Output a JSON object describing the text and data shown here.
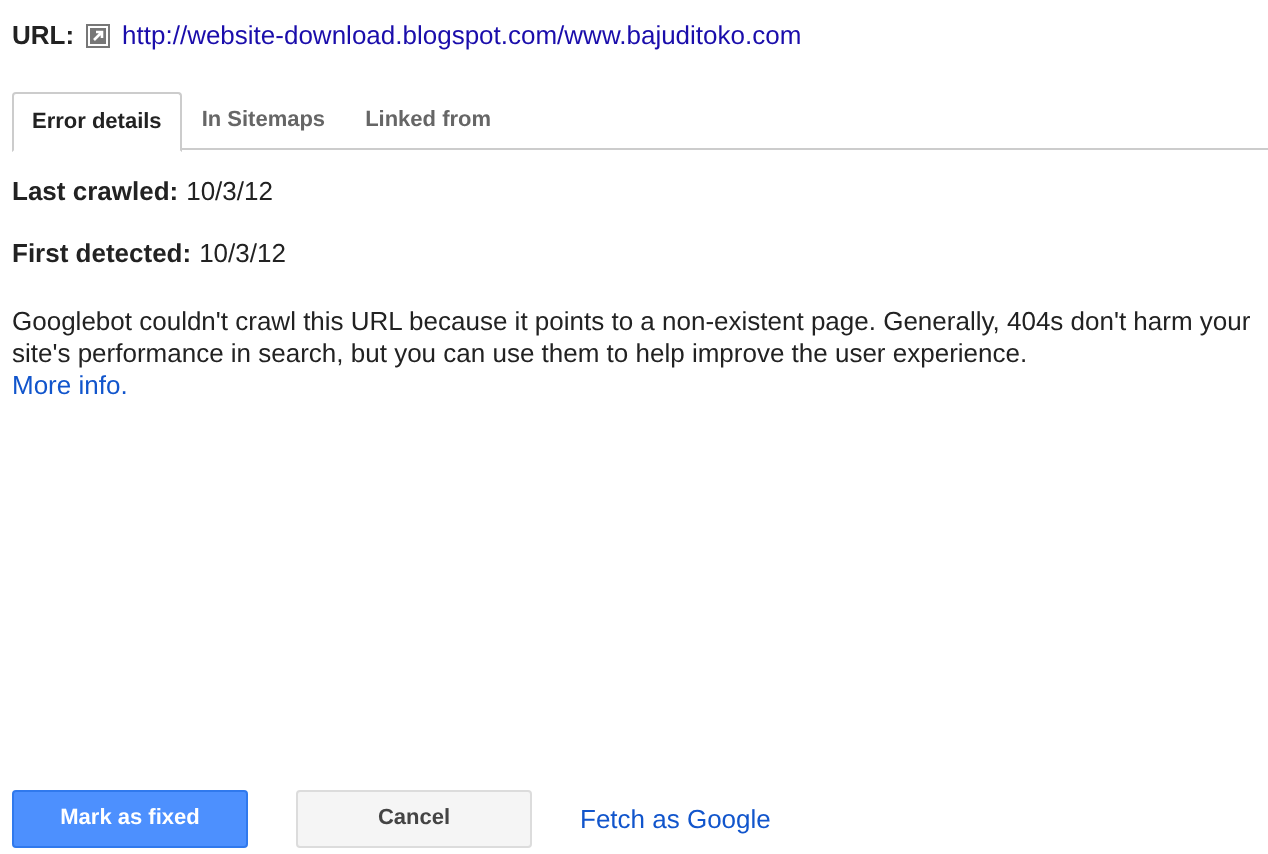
{
  "url": {
    "label": "URL:",
    "value": "http://website-download.blogspot.com/www.bajuditoko.com"
  },
  "tabs": [
    {
      "label": "Error details",
      "selected": true
    },
    {
      "label": "In Sitemaps",
      "selected": false
    },
    {
      "label": "Linked from",
      "selected": false
    }
  ],
  "details": [
    {
      "label": "Last crawled:",
      "value": "10/3/12"
    },
    {
      "label": "First detected:",
      "value": "10/3/12"
    }
  ],
  "description": "Googlebot couldn't crawl this URL because it points to a non-existent page. Generally, 404s don't harm your site's performance in search, but you can use them to help improve the user experience.",
  "more_link": "More info.",
  "actions": [
    {
      "kind": "primary",
      "label": "Mark as fixed"
    },
    {
      "kind": "default",
      "label": "Cancel"
    },
    {
      "kind": "link",
      "label": "Fetch as Google"
    }
  ]
}
